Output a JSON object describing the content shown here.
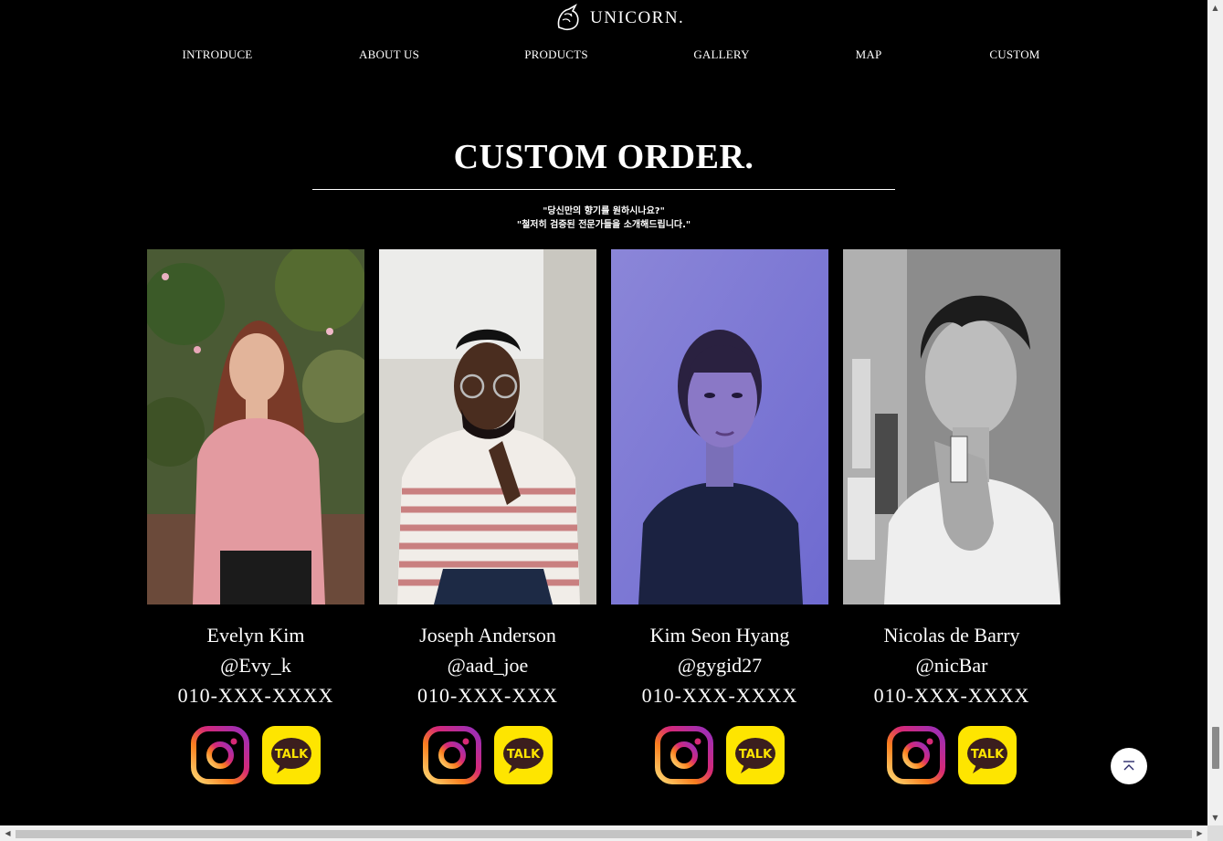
{
  "header": {
    "logo_text": "UNICORN.",
    "nav": [
      "INTRODUCE",
      "ABOUT US",
      "PRODUCTS",
      "GALLERY",
      "MAP",
      "CUSTOM"
    ]
  },
  "section": {
    "title": "CUSTOM ORDER.",
    "subtitle_line1": "\"당신만의 향기를 원하시나요?\"",
    "subtitle_line2": "\"철저히 검증된 전문가들을 소개해드립니다.\""
  },
  "perfumers": [
    {
      "name": "Evelyn Kim",
      "handle": "@Evy_k",
      "phone": "010-XXX-XXXX"
    },
    {
      "name": "Joseph Anderson",
      "handle": "@aad_joe",
      "phone": "010-XXX-XXX"
    },
    {
      "name": "Kim Seon Hyang",
      "handle": "@gygid27",
      "phone": "010-XXX-XXXX"
    },
    {
      "name": "Nicolas de Barry",
      "handle": "@nicBar",
      "phone": "010-XXX-XXXX"
    }
  ],
  "social": {
    "talk_label": "TALK"
  },
  "icons": [
    "unicorn-logo-icon",
    "instagram-icon",
    "kakaotalk-icon",
    "scroll-top-icon"
  ],
  "colors": {
    "background": "#000000",
    "text": "#ffffff",
    "kakao_yellow": "#FEE500",
    "insta_start": "#feda75",
    "insta_end": "#962fbf"
  }
}
